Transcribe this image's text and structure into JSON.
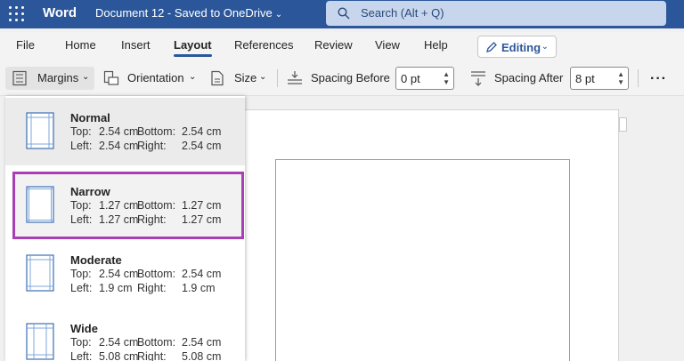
{
  "titlebar": {
    "app_name": "Word",
    "document": "Document 12 - Saved to OneDrive",
    "search_placeholder": "Search (Alt + Q)"
  },
  "tabs": [
    {
      "label": "File"
    },
    {
      "label": "Home"
    },
    {
      "label": "Insert"
    },
    {
      "label": "Layout",
      "active": true
    },
    {
      "label": "References"
    },
    {
      "label": "Review"
    },
    {
      "label": "View"
    },
    {
      "label": "Help"
    }
  ],
  "editing_mode": "Editing",
  "ribbon": {
    "margins": "Margins",
    "orientation": "Orientation",
    "size": "Size",
    "spacing_before_label": "Spacing Before",
    "spacing_before_value": "0 pt",
    "spacing_after_label": "Spacing After",
    "spacing_after_value": "8 pt",
    "more": "···"
  },
  "margin_options": [
    {
      "name": "Normal",
      "top_label": "Top:",
      "top": "2.54 cm",
      "bottom_label": "Bottom:",
      "bottom": "2.54 cm",
      "left_label": "Left:",
      "left": "2.54 cm",
      "right_label": "Right:",
      "right": "2.54 cm"
    },
    {
      "name": "Narrow",
      "top_label": "Top:",
      "top": "1.27 cm",
      "bottom_label": "Bottom:",
      "bottom": "1.27 cm",
      "left_label": "Left:",
      "left": "1.27 cm",
      "right_label": "Right:",
      "right": "1.27 cm"
    },
    {
      "name": "Moderate",
      "top_label": "Top:",
      "top": "2.54 cm",
      "bottom_label": "Bottom:",
      "bottom": "2.54 cm",
      "left_label": "Left:",
      "left": "1.9 cm",
      "right_label": "Right:",
      "right": "1.9 cm"
    },
    {
      "name": "Wide",
      "top_label": "Top:",
      "top": "2.54 cm",
      "bottom_label": "Bottom:",
      "bottom": "2.54 cm",
      "left_label": "Left:",
      "left": "5.08 cm",
      "right_label": "Right:",
      "right": "5.08 cm"
    }
  ],
  "colors": {
    "brand": "#2b579a",
    "highlight": "#a93fb5"
  }
}
